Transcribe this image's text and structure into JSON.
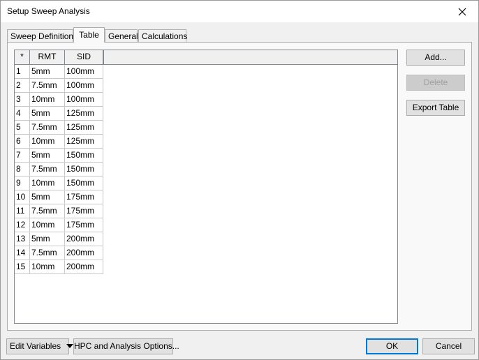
{
  "window": {
    "title": "Setup Sweep Analysis"
  },
  "tabs": [
    {
      "label": "Sweep Definitions",
      "active": false
    },
    {
      "label": "Table",
      "active": true
    },
    {
      "label": "General",
      "active": false
    },
    {
      "label": "Calculations",
      "active": false
    }
  ],
  "table": {
    "headers": [
      "*",
      "RMT",
      "SID"
    ],
    "rows": [
      [
        "1",
        "5mm",
        "100mm"
      ],
      [
        "2",
        "7.5mm",
        "100mm"
      ],
      [
        "3",
        "10mm",
        "100mm"
      ],
      [
        "4",
        "5mm",
        "125mm"
      ],
      [
        "5",
        "7.5mm",
        "125mm"
      ],
      [
        "6",
        "10mm",
        "125mm"
      ],
      [
        "7",
        "5mm",
        "150mm"
      ],
      [
        "8",
        "7.5mm",
        "150mm"
      ],
      [
        "9",
        "10mm",
        "150mm"
      ],
      [
        "10",
        "5mm",
        "175mm"
      ],
      [
        "11",
        "7.5mm",
        "175mm"
      ],
      [
        "12",
        "10mm",
        "175mm"
      ],
      [
        "13",
        "5mm",
        "200mm"
      ],
      [
        "14",
        "7.5mm",
        "200mm"
      ],
      [
        "15",
        "10mm",
        "200mm"
      ]
    ]
  },
  "side_buttons": {
    "add": "Add...",
    "delete": "Delete",
    "export": "Export Table"
  },
  "bottom": {
    "edit_variables": "Edit Variables",
    "hpc_options": "HPC and Analysis Options...",
    "ok": "OK",
    "cancel": "Cancel"
  },
  "icons": {
    "close": "close-icon",
    "dropdown": "dropdown-arrow-icon"
  }
}
